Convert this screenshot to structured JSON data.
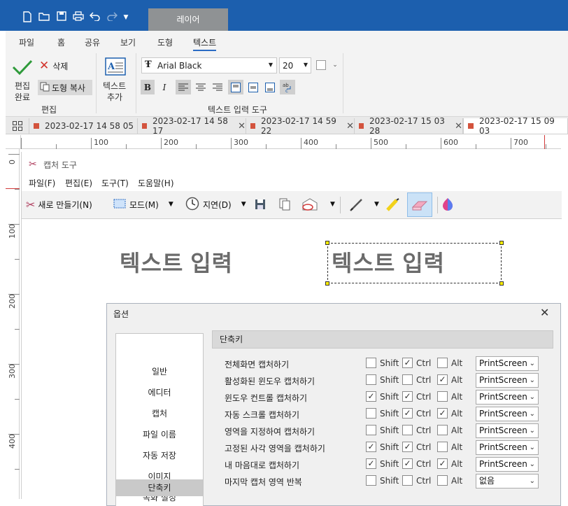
{
  "titlebar": {
    "layer_tab": "레이어"
  },
  "ribbon": {
    "menu": [
      "파일",
      "홈",
      "공유",
      "보기",
      "도형",
      "텍스트"
    ],
    "edit_done_label_1": "편집",
    "edit_done_label_2": "완료",
    "delete_label": "삭제",
    "shape_copy_label": "도형 복사",
    "group_edit_label": "편집",
    "add_text_label_1": "텍스트",
    "add_text_label_2": "추가",
    "font_name": "Arial Black",
    "font_size": "20",
    "group_text_label": "텍스트 입력 도구"
  },
  "tabs": [
    {
      "label": "2023-02-17 14 58 05",
      "active": false
    },
    {
      "label": "2023-02-17 14 58 17",
      "active": false
    },
    {
      "label": "2023-02-17 14 59 22",
      "active": false
    },
    {
      "label": "2023-02-17 15 03 28",
      "active": false
    },
    {
      "label": "2023-02-17 15 09 03",
      "active": true
    }
  ],
  "ruler_h": [
    "100",
    "200",
    "300",
    "400",
    "500",
    "600",
    "700"
  ],
  "ruler_v": [
    "0",
    "100",
    "200",
    "300",
    "400"
  ],
  "capture_tool": {
    "title": "캡처 도구",
    "menu": [
      "파일(F)",
      "편집(E)",
      "도구(T)",
      "도움말(H)"
    ],
    "new_label": "새로 만들기(N)",
    "mode_label": "모드(M)",
    "delay_label": "지연(D)"
  },
  "canvas_text": {
    "left": "텍스트 입력",
    "right": "텍스트 입력"
  },
  "dialog": {
    "title": "옵션",
    "nav": [
      "일반",
      "에디터",
      "캡처",
      "파일 이름",
      "자동 저장",
      "이미지",
      "녹화 설정",
      "단축키"
    ],
    "nav_active": "단축키",
    "panel_title": "단축키",
    "mod_labels": {
      "shift": "Shift",
      "ctrl": "Ctrl",
      "alt": "Alt"
    },
    "shortcuts": [
      {
        "label": "전체화면 캡처하기",
        "shift": false,
        "ctrl": true,
        "alt": false,
        "key": "PrintScreen"
      },
      {
        "label": "활성화된 윈도우 캡처하기",
        "shift": false,
        "ctrl": false,
        "alt": true,
        "key": "PrintScreen"
      },
      {
        "label": "윈도우 컨트롤 캡처하기",
        "shift": true,
        "ctrl": true,
        "alt": false,
        "key": "PrintScreen"
      },
      {
        "label": "자동 스크롤 캡처하기",
        "shift": false,
        "ctrl": true,
        "alt": true,
        "key": "PrintScreen"
      },
      {
        "label": "영역을 지정하여 캡처하기",
        "shift": false,
        "ctrl": false,
        "alt": false,
        "key": "PrintScreen"
      },
      {
        "label": "고정된 사각 영역을 캡처하기",
        "shift": true,
        "ctrl": true,
        "alt": false,
        "key": "PrintScreen"
      },
      {
        "label": "내 마음대로 캡처하기",
        "shift": true,
        "ctrl": true,
        "alt": true,
        "key": "PrintScreen"
      },
      {
        "label": "마지막 캡처 영역 반복",
        "shift": false,
        "ctrl": false,
        "alt": false,
        "key": "없음"
      }
    ]
  },
  "colors": {
    "titlebar": "#1c5fae",
    "accent": "#2b6cc4",
    "tab_marker": "#d3533d"
  }
}
